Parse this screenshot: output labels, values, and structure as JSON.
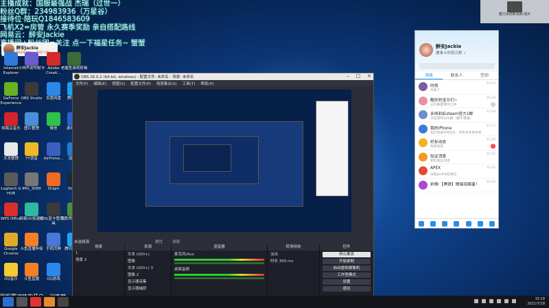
{
  "overlay": {
    "lines": [
      "主播成就：国服最强战 杰瑞（过世一）",
      "粉丝Q群：234983936（万星谷）",
      "接待位·陪玩Q1846583609",
      "飞机X2=房管 永久赛季奖励 亲自搭配路线",
      "网易云：醉安Jackie",
      "直播间+粉丝团=关注 点一下福星任务~ 蟹蟹"
    ],
    "ticker": "国服赛冲锋的开启，训练营"
  },
  "streamer_card": {
    "name": "醉安Jackie",
    "subtitle": "Yesterday · 342 UP"
  },
  "desktop_icons": [
    {
      "label": "Internet Explorer",
      "color": "#2f7ad8"
    },
    {
      "label": "小林声调号配卡",
      "color": "#6b5bd2"
    },
    {
      "label": "Adobe Creati...",
      "color": "#d32a2a"
    },
    {
      "label": "老磨鱼游戏剪辑",
      "color": "#3d6a3b"
    },
    {
      "label": "GeForce Experience",
      "color": "#6ab023"
    },
    {
      "label": "OBS Studio",
      "color": "#3a3a3a"
    },
    {
      "label": "百度网盘",
      "color": "#2b88e8"
    },
    {
      "label": "腾讯QQ",
      "color": "#1a9ef3"
    },
    {
      "label": "网易云音乐",
      "color": "#d3242a"
    },
    {
      "label": "图片整理",
      "color": "#4a90d9"
    },
    {
      "label": "微信",
      "color": "#2fc24a"
    },
    {
      "label": "游戏加速",
      "color": "#2a62c8"
    },
    {
      "label": "文本整理",
      "color": "#e8e8e8"
    },
    {
      "label": "YY语音",
      "color": "#f0b825"
    },
    {
      "label": "AirPrime...",
      "color": "#3a5fbe"
    },
    {
      "label": "加速器",
      "color": "#2379d3"
    },
    {
      "label": "Logitech G HUB",
      "color": "#5a5a5a"
    },
    {
      "label": "IMG_3089",
      "color": "#777"
    },
    {
      "label": "Origin",
      "color": "#f06a24"
    },
    {
      "label": "Steam",
      "color": "#1b2838"
    },
    {
      "label": "WPS Office",
      "color": "#d9302c"
    },
    {
      "label": "网易UU加速器",
      "color": "#2fb9a4"
    },
    {
      "label": "ROG显卡管理工具",
      "color": "#3a3a3a"
    },
    {
      "label": "我的世界网易版",
      "color": "#4a8f3a"
    },
    {
      "label": "Google Chrome",
      "color": "#e1a92a"
    },
    {
      "label": "斗鱼直播伴侣",
      "color": "#f48025"
    },
    {
      "label": "手机同屏",
      "color": "#4a78d9"
    },
    {
      "label": "腾讯应用宝",
      "color": "#24a0f3"
    },
    {
      "label": "QQ音乐",
      "color": "#f4cc31"
    },
    {
      "label": "斗鱼直播",
      "color": "#f48025"
    },
    {
      "label": "QQ游戏",
      "color": "#2b88e8"
    }
  ],
  "obs": {
    "title": "OBS 26.0.2 (64-bit, windows) - 配置文件: 未命名 - 场景: 未命名",
    "menu": [
      "文件(F)",
      "编辑(E)",
      "视图(V)",
      "配置文件(P)",
      "场景集合(S)",
      "工具(T)",
      "帮助(H)"
    ],
    "panels": {
      "scenes": {
        "title": "场景",
        "items": [
          "1",
          "场景 2"
        ]
      },
      "sources": {
        "title": "来源",
        "items": [
          "文本 (GDI+)",
          "图像",
          "文本 (GDI+) 3",
          "图像 2",
          "显示器采集",
          "显示器捕获"
        ]
      },
      "mixer": {
        "title": "混音器",
        "tracks": [
          "麦克风/Aux",
          "桌面音频"
        ]
      },
      "transitions": {
        "title": "转场特效",
        "type": "淡出",
        "duration_label": "时长",
        "duration": "300 ms"
      },
      "controls": {
        "title": "控件",
        "buttons": [
          "停止推流",
          "开始录制",
          "启动虚拟摄像机",
          "工作室模式",
          "设置",
          "退出"
        ]
      }
    },
    "no_source": "未选择源",
    "properties": "属性",
    "filters": "滤镜"
  },
  "qq": {
    "nickname": "醉安Jackie",
    "signature": "要奋斗你就沉默 ✓",
    "tabs": [
      "消息",
      "联系人",
      "空间"
    ],
    "items": [
      {
        "title": "时雨",
        "preview": "月薪了",
        "time": "15:19",
        "badge": "",
        "color": "#7c5b9f"
      },
      {
        "title": "酷安的宝贝们~",
        "preview": "正在群里等你上线",
        "time": "15:18",
        "badge": "2",
        "color": "#ea8fa7"
      },
      {
        "title": "永恒彩虹steam官方1群",
        "preview": "深度游戏讨论群（群不错值）",
        "time": "15:18",
        "badge": "",
        "color": "#6b8fd3"
      },
      {
        "title": "我的iPhone",
        "preview": "也已登录手机QQ，可传文件到手机",
        "time": "15:17",
        "badge": "",
        "color": "#3b7ad6"
      },
      {
        "title": "好友动态",
        "preview": "有新动态",
        "time": "15:16",
        "badge": "1",
        "color": "#f4b31d"
      },
      {
        "title": "验证消息",
        "preview": "新的验证消息",
        "time": "15:16",
        "badge": "",
        "color": "#f39a21"
      },
      {
        "title": "APEX",
        "preview": "没有Jackie在线吗",
        "time": "12:45",
        "badge": "",
        "color": "#e14b36"
      },
      {
        "title": "祈祷:【黑铁】微瑞泡面篷！",
        "preview": "",
        "time": "15:09",
        "badge": "",
        "color": "#aa4bd1"
      }
    ]
  },
  "notification": {
    "text": "猫刀涂鸦新视频 成片"
  },
  "taskbar": {
    "time": "15:19",
    "date": "2021/7/18"
  }
}
